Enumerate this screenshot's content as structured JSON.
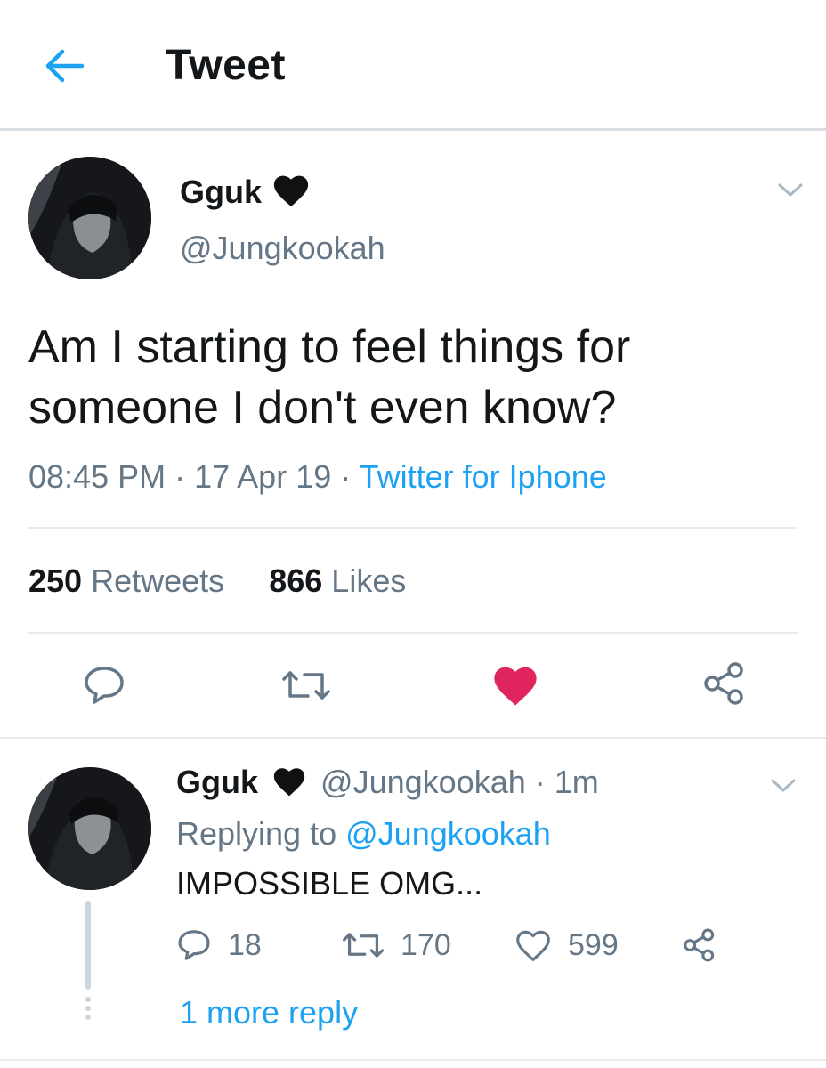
{
  "header": {
    "title": "Tweet",
    "back_icon": "arrow-left-icon"
  },
  "colors": {
    "accent": "#1da1f2",
    "text": "#14171a",
    "muted": "#657786",
    "like_active": "#e0245e",
    "divider": "#e6ecf0"
  },
  "tweet": {
    "author_name": "Gguk",
    "author_handle": "@Jungkookah",
    "text_line1": "Am I starting to feel things for",
    "text_line2": "someone I don't even know?",
    "time": "08:45 PM",
    "date": "17 Apr 19",
    "source": "Twitter for Iphone",
    "retweets_count": "250",
    "retweets_label": "Retweets",
    "likes_count": "866",
    "likes_label": "Likes",
    "liked": true
  },
  "reply": {
    "author_name": "Gguk",
    "author_handle": "@Jungkookah",
    "age": "1m",
    "replying_prefix": "Replying to",
    "replying_to": "@Jungkookah",
    "text": "IMPOSSIBLE OMG...",
    "reply_count": "18",
    "retweet_count": "170",
    "like_count": "599",
    "more_replies": "1 more reply"
  }
}
